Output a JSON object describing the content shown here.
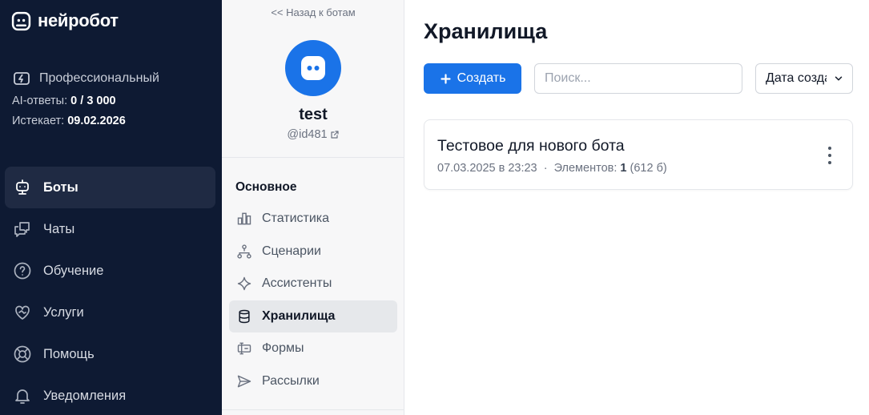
{
  "app": {
    "logo_text": "нейробот"
  },
  "plan": {
    "name": "Профессиональный",
    "ai_label": "AI-ответы:",
    "ai_value": "0 / 3 000",
    "expires_label": "Истекает:",
    "expires_value": "09.02.2026"
  },
  "nav": [
    {
      "label": "Боты",
      "icon": "bot-icon",
      "active": true
    },
    {
      "label": "Чаты",
      "icon": "chat-icon"
    },
    {
      "label": "Обучение",
      "icon": "help-circle-icon"
    },
    {
      "label": "Услуги",
      "icon": "handshake-heart-icon"
    },
    {
      "label": "Помощь",
      "icon": "lifebuoy-icon"
    },
    {
      "label": "Уведомления",
      "icon": "bell-icon"
    }
  ],
  "bot": {
    "back_label": "<< Назад к ботам",
    "name": "test",
    "handle": "@id481",
    "section_title": "Основное",
    "menu": [
      {
        "label": "Статистика",
        "icon": "bar-chart-icon"
      },
      {
        "label": "Сценарии",
        "icon": "flow-icon"
      },
      {
        "label": "Ассистенты",
        "icon": "sparkle-icon"
      },
      {
        "label": "Хранилища",
        "icon": "database-icon",
        "active": true
      },
      {
        "label": "Формы",
        "icon": "form-icon"
      },
      {
        "label": "Рассылки",
        "icon": "send-icon"
      }
    ]
  },
  "main": {
    "title": "Хранилища",
    "create_label": "Создать",
    "search_placeholder": "Поиск...",
    "sort_label": "Дата создания",
    "items": [
      {
        "title": "Тестовое для нового бота",
        "date": "07.03.2025 в 23:23",
        "sep": "·",
        "elements_label": "Элементов:",
        "elements_count": "1",
        "size": "(612 б)"
      }
    ]
  },
  "colors": {
    "sidebar_bg": "#0e1a33",
    "accent": "#1a73e8",
    "panel_bg": "#f7f7f8"
  }
}
